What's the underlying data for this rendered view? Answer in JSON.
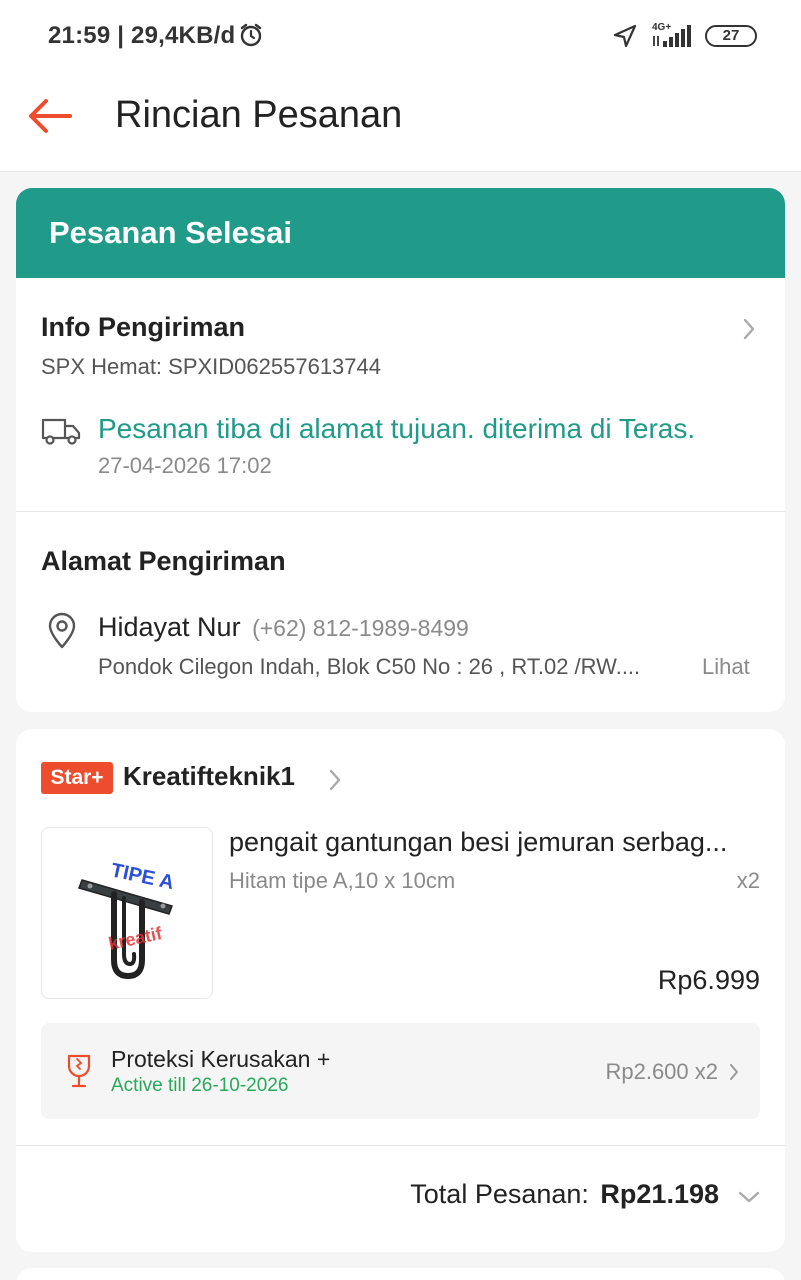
{
  "status_bar": {
    "time": "21:59 | 29,4KB/d",
    "network_label": "4G+",
    "battery": "27"
  },
  "header": {
    "title": "Rincian Pesanan"
  },
  "order_status": {
    "label": "Pesanan Selesai",
    "color": "#209a89"
  },
  "shipping_info": {
    "title": "Info Pengiriman",
    "courier_line": "SPX Hemat: SPXID062557613744",
    "tracking_status": "Pesanan tiba di alamat tujuan. diterima di Teras.",
    "tracking_time": "27-04-2026 17:02"
  },
  "shipping_address": {
    "title": "Alamat Pengiriman",
    "name": "Hidayat Nur",
    "phone": "(+62) 812-1989-8499",
    "address": "Pondok Cilegon Indah, Blok C50 No : 26 , RT.02 /RW....",
    "view_link": "Lihat"
  },
  "shop": {
    "badge": "Star+",
    "name": "Kreatifteknik1",
    "badge_color": "#ee4d2d"
  },
  "product": {
    "name": "pengait gantungan besi jemuran serbag...",
    "variant": "Hitam tipe A,10 x 10cm",
    "quantity": "x2",
    "price": "Rp6.999",
    "image_text_top": "TIPE A",
    "image_text_watermark": "kreatif"
  },
  "protection": {
    "title": "Proteksi Kerusakan +",
    "active_until": "Active till 26-10-2026",
    "price": "Rp2.600 x2"
  },
  "total": {
    "label": "Total Pesanan:",
    "value": "Rp21.198"
  }
}
